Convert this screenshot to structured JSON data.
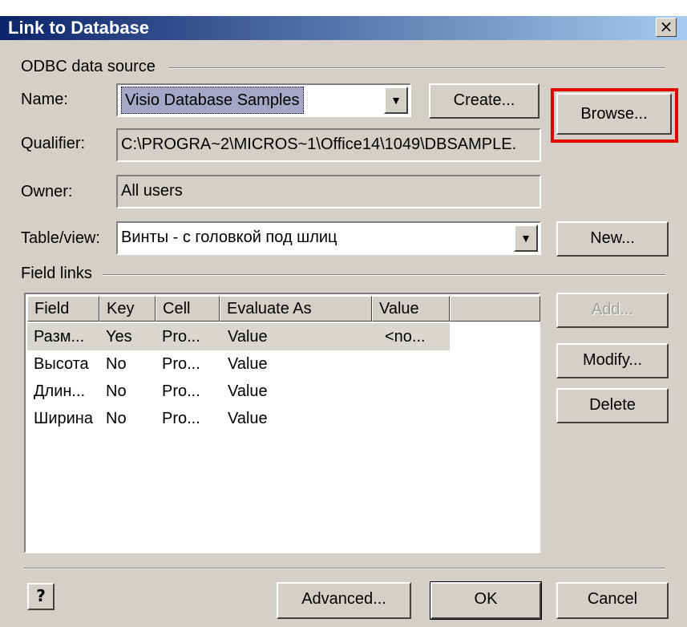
{
  "window": {
    "title": "Link to Database",
    "close_glyph": "×"
  },
  "odbc": {
    "group_label": "ODBC data source",
    "name_label": "Name:",
    "name_value": "Visio Database Samples",
    "create_button": "Create...",
    "browse_button": "Browse...",
    "qualifier_label": "Qualifier:",
    "qualifier_value": "C:\\PROGRA~2\\MICROS~1\\Office14\\1049\\DBSAMPLE.",
    "owner_label": "Owner:",
    "owner_value": "All users"
  },
  "table": {
    "label": "Table/view:",
    "value": "Винты - с головкой под шлиц",
    "new_button": "New..."
  },
  "field_links": {
    "group_label": "Field links",
    "columns": [
      "Field",
      "Key",
      "Cell",
      "Evaluate As",
      "Value"
    ],
    "rows": [
      [
        "Разм...",
        "Yes",
        "Pro...",
        "Value",
        "<no..."
      ],
      [
        "Высота",
        "No",
        "Pro...",
        "Value",
        ""
      ],
      [
        "Длин...",
        "No",
        "Pro...",
        "Value",
        ""
      ],
      [
        "Ширина",
        "No",
        "Pro...",
        "Value",
        ""
      ]
    ],
    "add_button": "Add...",
    "modify_button": "Modify...",
    "delete_button": "Delete"
  },
  "footer": {
    "help_glyph": "?",
    "advanced_button": "Advanced...",
    "ok_button": "OK",
    "cancel_button": "Cancel"
  },
  "colors": {
    "highlight": "#e00000",
    "titlebar_start": "#0a246a",
    "face": "#d4d0c8"
  }
}
